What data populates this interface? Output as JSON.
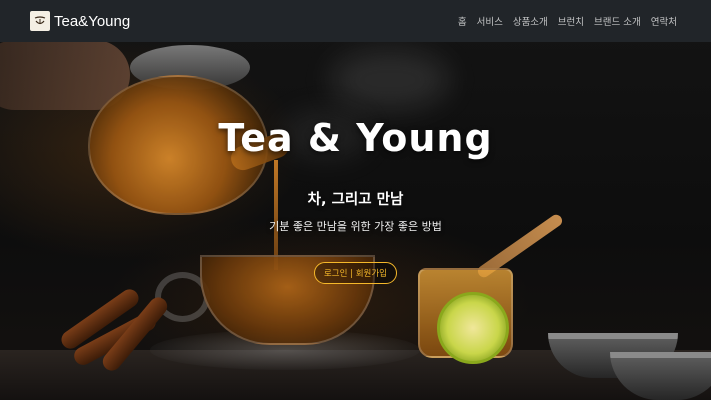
{
  "navbar": {
    "brand": {
      "name": "Tea&Young",
      "logo_icon": "teacup-logo-icon"
    },
    "links": [
      {
        "label": "홈"
      },
      {
        "label": "서비스"
      },
      {
        "label": "상품소개"
      },
      {
        "label": "브런치"
      },
      {
        "label": "브랜드 소개"
      },
      {
        "label": "연락처"
      }
    ]
  },
  "hero": {
    "title": "Tea & Young",
    "subtitle": "차, 그리고 만남",
    "description": "기분 좋은 만남을 위한 가장 좋은 방법",
    "auth_button_label": "로그인 | 회원가입",
    "background_image": "teapot-pouring-tea-photo"
  },
  "colors": {
    "navbar_bg": "#212529",
    "accent": "#f5b82a",
    "nav_link": "rgba(255,255,255,0.72)"
  }
}
